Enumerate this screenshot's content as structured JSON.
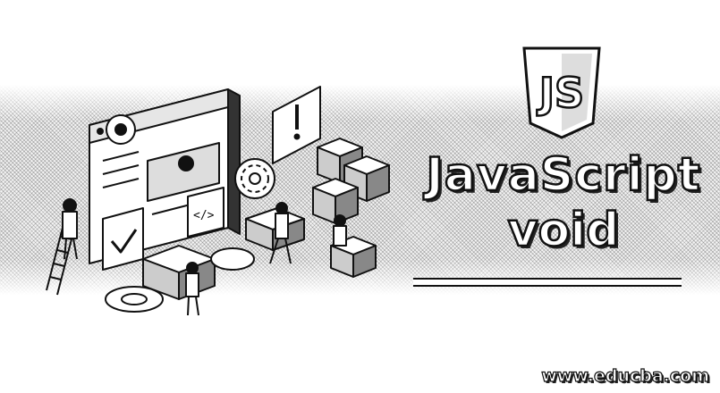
{
  "title": {
    "line1": "JavaScript",
    "line2": "void"
  },
  "logo": {
    "text": "JS",
    "icon": "javascript-shield-icon"
  },
  "footer": {
    "url": "www.educba.com"
  },
  "illustration": {
    "icons": [
      "browser-window-icon",
      "gear-icon",
      "code-tag-icon",
      "checkmark-icon",
      "exclamation-icon",
      "cube-stack-icon",
      "person-icon",
      "ladder-icon"
    ]
  },
  "colors": {
    "background": "#ffffff",
    "ink": "#111111"
  }
}
